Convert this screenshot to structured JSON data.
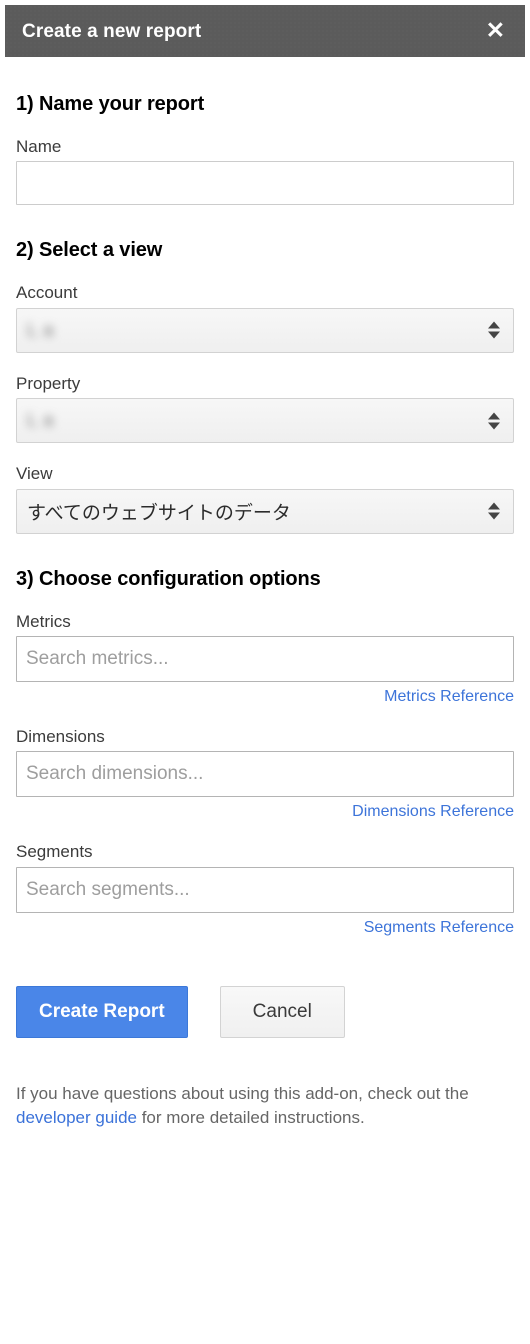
{
  "dialog": {
    "title": "Create a new report",
    "close_icon": "close-icon"
  },
  "sections": {
    "name": {
      "heading": "1) Name your report",
      "name_label": "Name",
      "name_value": "",
      "name_placeholder": ""
    },
    "view": {
      "heading": "2) Select a view",
      "account_label": "Account",
      "account_value": "L a",
      "property_label": "Property",
      "property_value": "L a",
      "view_label": "View",
      "view_value": "すべてのウェブサイトのデータ"
    },
    "config": {
      "heading": "3) Choose configuration options",
      "metrics_label": "Metrics",
      "metrics_placeholder": "Search metrics...",
      "metrics_value": "",
      "metrics_reference": "Metrics Reference",
      "dimensions_label": "Dimensions",
      "dimensions_placeholder": "Search dimensions...",
      "dimensions_value": "",
      "dimensions_reference": "Dimensions Reference",
      "segments_label": "Segments",
      "segments_placeholder": "Search segments...",
      "segments_value": "",
      "segments_reference": "Segments Reference"
    }
  },
  "actions": {
    "create_label": "Create Report",
    "cancel_label": "Cancel"
  },
  "footer": {
    "text_before": "If you have questions about using this add-on, check out the ",
    "link_text": "developer guide",
    "text_after": " for more detailed instructions."
  },
  "colors": {
    "titlebar_bg": "#5b5b5b",
    "primary_button": "#4a86e8",
    "link": "#3d74d9",
    "input_border": "#cccccc"
  }
}
